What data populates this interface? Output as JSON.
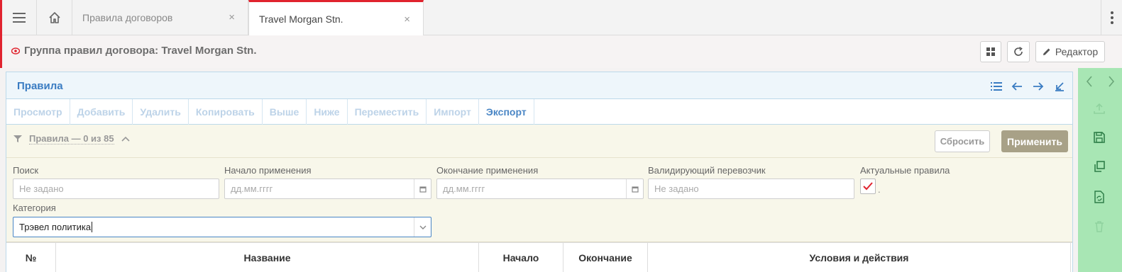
{
  "tabs": {
    "home_icon": "home-icon",
    "items": [
      {
        "label": "Правила договоров",
        "close": "×"
      },
      {
        "label": "Travel Morgan Stn.",
        "close": "×"
      }
    ]
  },
  "header": {
    "title": "Группа правил договора: Travel Morgan Stn.",
    "editor_label": "Редактор"
  },
  "panel": {
    "title": "Правила",
    "toolbar": [
      "Просмотр",
      "Добавить",
      "Удалить",
      "Копировать",
      "Выше",
      "Ниже",
      "Переместить",
      "Импорт",
      "Экспорт"
    ],
    "active_toolbar_item": "Экспорт"
  },
  "filter": {
    "summary": "Правила — 0 из 85",
    "reset_label": "Сбросить",
    "apply_label": "Применить",
    "search": {
      "label": "Поиск",
      "placeholder": "Не задано"
    },
    "start": {
      "label": "Начало применения",
      "placeholder": "дд.мм.гггг"
    },
    "end": {
      "label": "Окончание применения",
      "placeholder": "дд.мм.гггг"
    },
    "carrier": {
      "label": "Валидирующий перевозчик",
      "placeholder": "Не задано"
    },
    "actual": {
      "label": "Актуальные правила",
      "checked": true,
      "suffix": "."
    },
    "category": {
      "label": "Категория",
      "value": "Трэвел политика"
    }
  },
  "table": {
    "columns": [
      "№",
      "Название",
      "Начало",
      "Окончание",
      "Условия и действия"
    ]
  },
  "colors": {
    "accent_red": "#e0232e",
    "link_blue": "#3a7cc2",
    "rail_green": "#a8e6b4",
    "apply_button": "#a8a187"
  }
}
